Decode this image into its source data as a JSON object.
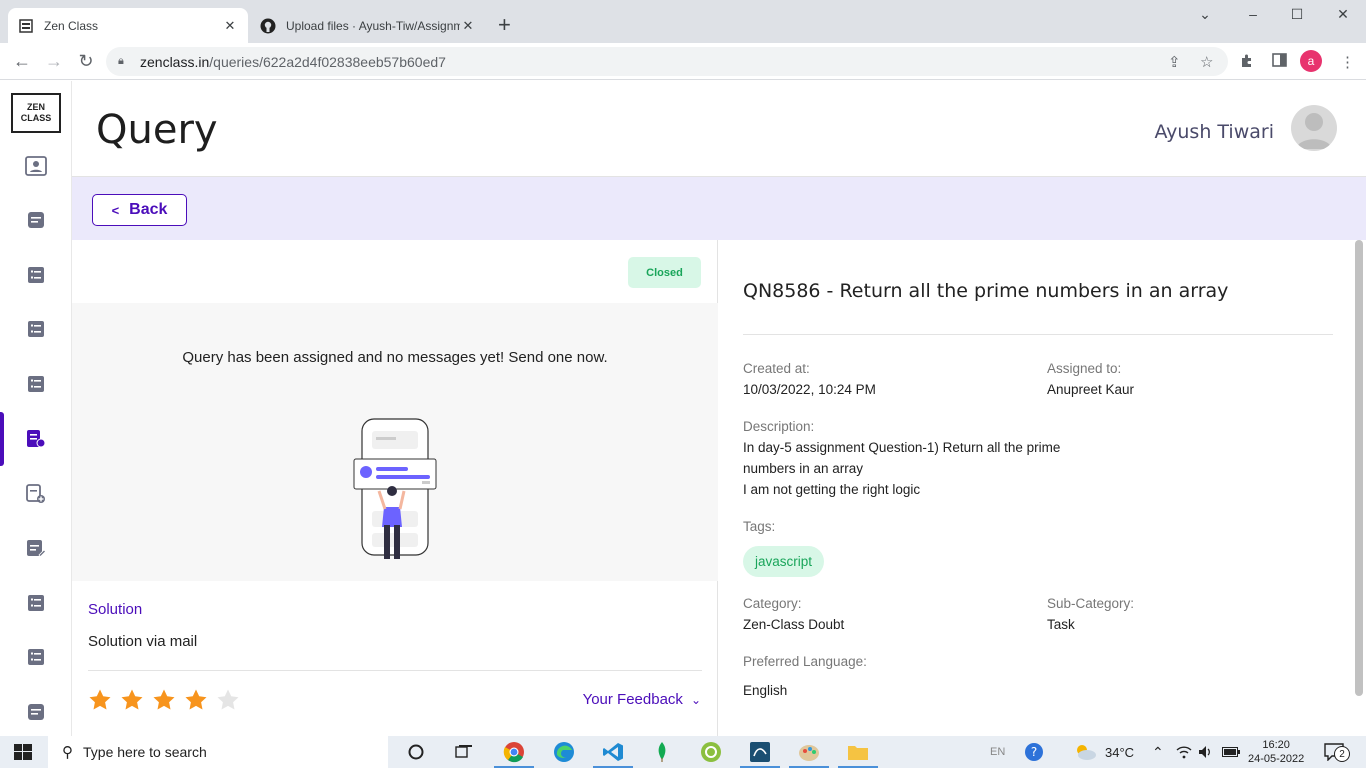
{
  "browser": {
    "tabs": [
      {
        "title": "Zen Class",
        "active": true
      },
      {
        "title": "Upload files · Ayush-Tiw/Assignm",
        "active": false
      }
    ],
    "url_host": "zenclass.in",
    "url_path": "/queries/622a2d4f02838eeb57b60ed7",
    "profile_initial": "a"
  },
  "app": {
    "logo_line1": "ZEN",
    "logo_line2": "CLASS",
    "page_title": "Query",
    "user_name": "Ayush Tiwari",
    "back_label": "Back",
    "accent": "#4b0dba"
  },
  "query": {
    "status": "Closed",
    "empty_message": "Query has been assigned and no messages yet! Send one now.",
    "solution_label": "Solution",
    "solution_text": "Solution via mail",
    "rating": 4,
    "rating_max": 5,
    "feedback_label": "Your Feedback",
    "title": "QN8586 - Return all the prime numbers in an array",
    "created_label": "Created at:",
    "created_value": "10/03/2022, 10:24 PM",
    "assigned_label": "Assigned to:",
    "assigned_value": "Anupreet Kaur",
    "description_label": "Description:",
    "description_line1": "In day-5 assignment Question-1) Return all the prime",
    "description_line2": "numbers in an array",
    "description_line3": "I am not getting the right logic",
    "tags_label": "Tags:",
    "tag": "javascript",
    "category_label": "Category:",
    "category_value": "Zen-Class Doubt",
    "subcategory_label": "Sub-Category:",
    "subcategory_value": "Task",
    "language_label": "Preferred Language:",
    "language_value": "English"
  },
  "taskbar": {
    "search_placeholder": "Type here to search",
    "language": "EN",
    "temperature": "34°C",
    "time": "16:20",
    "date": "24-05-2022",
    "notifications": "2"
  }
}
